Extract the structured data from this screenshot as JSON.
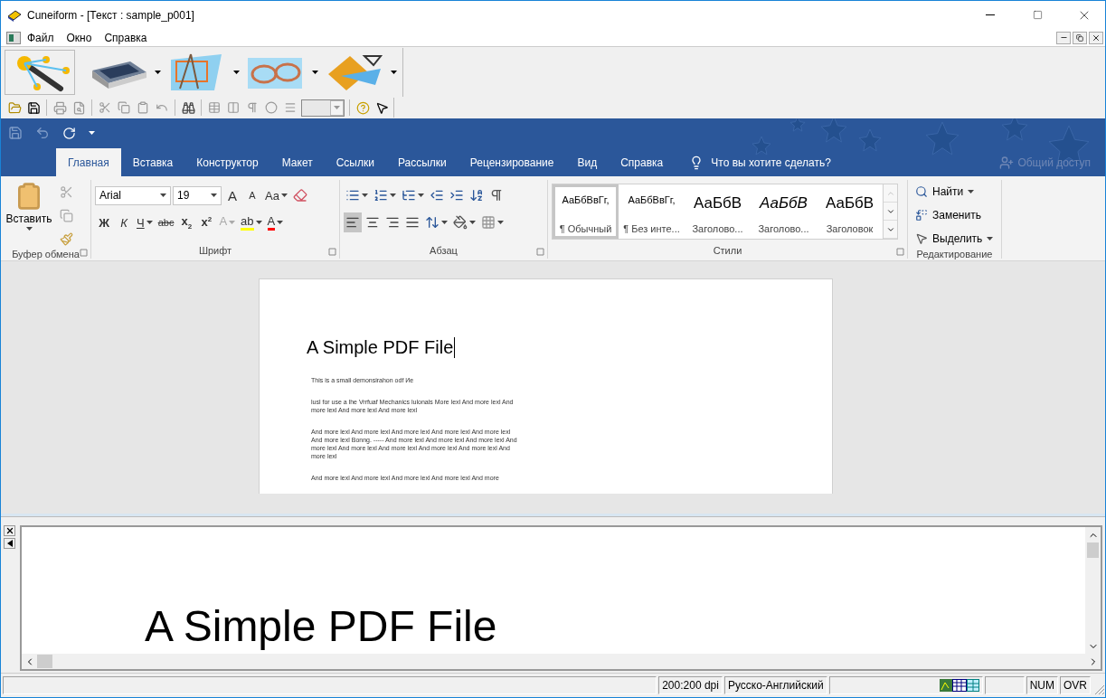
{
  "window": {
    "title": "Cuneiform - [Текст : sample_p001]"
  },
  "menu": [
    "Файл",
    "Окно",
    "Справка"
  ],
  "word": {
    "tabs": [
      {
        "label": "Главная",
        "selected": true
      },
      {
        "label": "Вставка",
        "selected": false
      },
      {
        "label": "Конструктор",
        "selected": false
      },
      {
        "label": "Макет",
        "selected": false
      },
      {
        "label": "Ссылки",
        "selected": false
      },
      {
        "label": "Рассылки",
        "selected": false
      },
      {
        "label": "Рецензирование",
        "selected": false
      },
      {
        "label": "Вид",
        "selected": false
      },
      {
        "label": "Справка",
        "selected": false
      }
    ],
    "tell_me": "Что вы хотите сделать?",
    "share": {
      "label": "Общий доступ",
      "disabled": true
    },
    "clipboard": {
      "paste": "Вставить",
      "group": "Буфер обмена"
    },
    "font": {
      "group": "Шрифт",
      "name": "Arial",
      "size": "19",
      "grow": "A",
      "shrink": "A",
      "case": "Aa",
      "buttons": [
        {
          "kind": "bold",
          "label": "Ж"
        },
        {
          "kind": "italic",
          "label": "К"
        },
        {
          "kind": "underline",
          "label": "Ч"
        },
        {
          "kind": "strike",
          "label": "abc"
        },
        {
          "kind": "sub",
          "label": "x$_{2}$"
        },
        {
          "kind": "sup",
          "label": "x$^{2}$"
        }
      ],
      "effects": {
        "label": "A",
        "disabled": true
      },
      "highlight": "ab",
      "font_color_label": "A"
    },
    "paragraph": {
      "group": "Абзац",
      "align": [
        {
          "kind": "left",
          "selected": true
        },
        {
          "kind": "center",
          "selected": false
        },
        {
          "kind": "right",
          "selected": false
        },
        {
          "kind": "justify",
          "selected": false
        }
      ]
    },
    "styles": {
      "group": "Стили",
      "items": [
        {
          "kind": "normal",
          "preview": "АаБбВвГг,",
          "name": "¶ Обычный",
          "selected": true
        },
        {
          "kind": "normal",
          "preview": "АаБбВвГг,",
          "name": "¶ Без инте...",
          "selected": false
        },
        {
          "kind": "heading",
          "preview": "АаБбВ",
          "name": "Заголово...",
          "selected": false
        },
        {
          "kind": "italic",
          "preview": "АаБбВ",
          "name": "Заголово...",
          "selected": false
        },
        {
          "kind": "heading",
          "preview": "АаБбВ",
          "name": "Заголовок",
          "selected": false
        }
      ]
    },
    "editing": {
      "group": "Редактирование",
      "find": "Найти",
      "replace": "Заменить",
      "select": "Выделить"
    }
  },
  "document": {
    "title": "A Simple PDF File",
    "paragraphs": [
      "This is a small demonsirahon odf Ие",
      "lusl for use a lhe Vrrfuaf Mechanics lulonals More lexl And more lexl And more lexl And more lexl And more lexl",
      "And more lexl And more lexl And more lexl And more lexl And more lexl And more lexl Bonng. ----- And more lexl And more lexl And more lexl And more lexl And more lexl And more lexl And more lexl And more lexl And more lexl",
      "And more lexl And more lexl And more lexl And more lexl And more"
    ]
  },
  "preview": {
    "text": "A Simple PDF File"
  },
  "status_bar": [
    {
      "kind": "empty"
    },
    {
      "kind": "text",
      "text": "200:200 dpi"
    },
    {
      "kind": "text",
      "text": "Русско-Английский"
    },
    {
      "kind": "icons"
    },
    {
      "kind": "empty"
    },
    {
      "kind": "text",
      "text": "NUM"
    },
    {
      "kind": "text",
      "text": "OVR"
    }
  ]
}
